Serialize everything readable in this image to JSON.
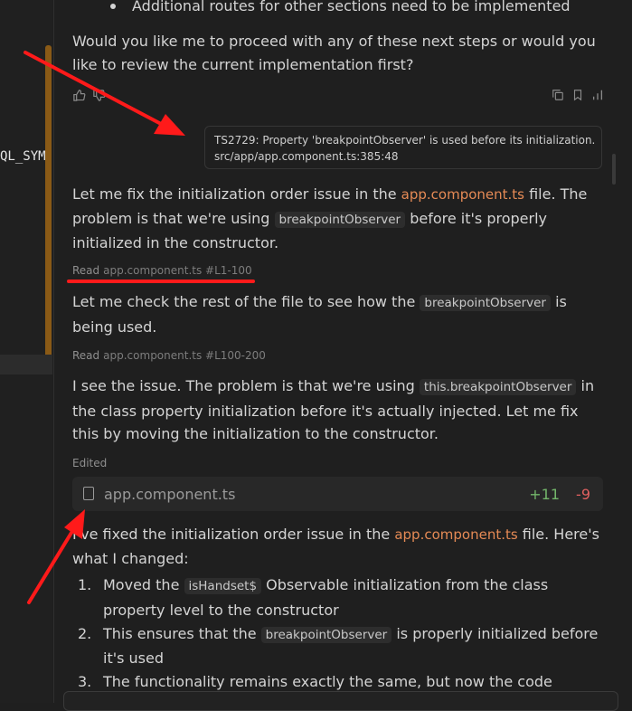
{
  "left_panel": {
    "code_fragment": "QL_SYM"
  },
  "chat": {
    "bullet_text": "Additional routes for other sections need to be implemented",
    "question": "Would you like me to proceed with any of these next steps or would you like to review the current implementation first?",
    "error": {
      "line1": "TS2729: Property 'breakpointObserver' is used before its initialization.",
      "line2": "src/app/app.component.ts:385:48"
    },
    "msg1": {
      "pre": "Let me fix the initialization order issue in the ",
      "file": "app.component.ts",
      "mid": " file. The problem is that we're using ",
      "code": "breakpointObserver",
      "post": " before it's properly initialized in the constructor."
    },
    "read1": {
      "label": "Read",
      "file": "app.component.ts #L1-100"
    },
    "msg2": {
      "pre": "Let me check the rest of the file to see how the ",
      "code": "breakpointObserver",
      "post": " is being used."
    },
    "read2": {
      "label": "Read",
      "file": "app.component.ts #L100-200"
    },
    "msg3": {
      "pre": "I see the issue. The problem is that we're using ",
      "code": "this.breakpointObserver",
      "post": " in the class property initialization before it's actually injected. Let me fix this by moving the initialization to the constructor."
    },
    "edited": {
      "label": "Edited",
      "file": "app.component.ts",
      "additions": "+11",
      "deletions": "-9"
    },
    "msg4": {
      "pre": "I've fixed the initialization order issue in the ",
      "file": "app.component.ts",
      "post": " file. Here's what I changed:"
    },
    "changes": [
      {
        "num": "1.",
        "pre": "Moved the ",
        "code": "isHandset$",
        "post": " Observable initialization from the class property level to the constructor"
      },
      {
        "num": "2.",
        "pre": "This ensures that the ",
        "code": "breakpointObserver",
        "post": " is properly initialized before it's used"
      },
      {
        "num": "3.",
        "pre": "The functionality remains exactly the same, but now the code",
        "code": "",
        "post": ""
      }
    ]
  },
  "colors": {
    "background": "#1f1f1f",
    "file_link": "#e58a55",
    "additions": "#73b66a",
    "deletions": "#e06060",
    "annotation_red": "#ff1a1a",
    "scroll_accent": "#8a5a16"
  }
}
